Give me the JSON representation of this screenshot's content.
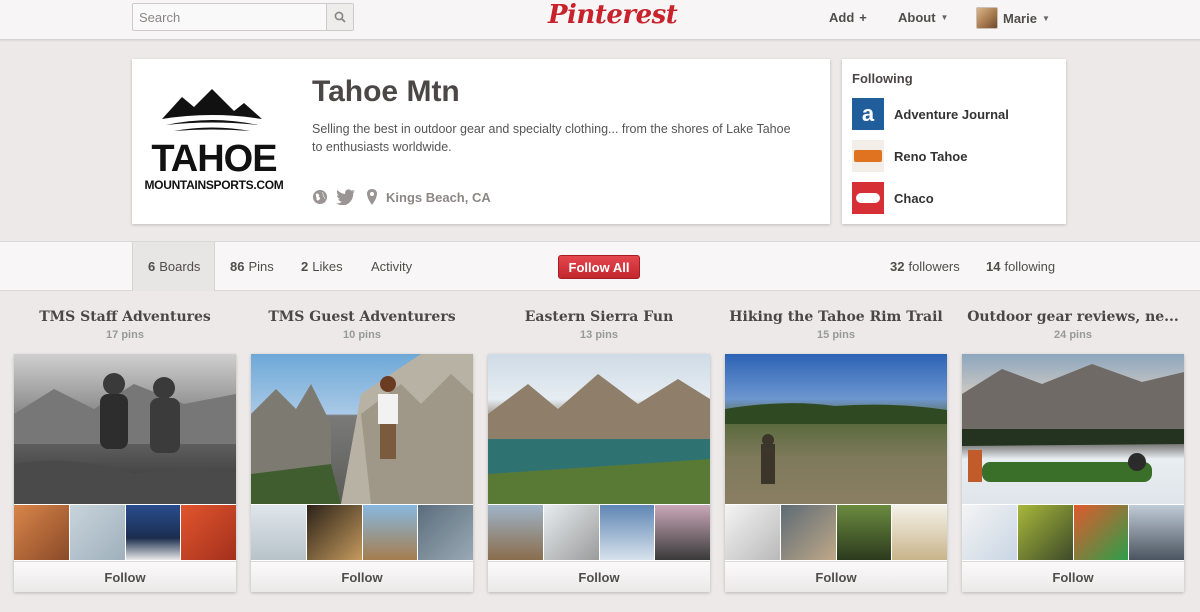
{
  "header": {
    "search_placeholder": "Search",
    "logo": "Pinterest",
    "nav": {
      "add": "Add",
      "about": "About",
      "user": "Marie"
    }
  },
  "profile": {
    "name": "Tahoe Mtn",
    "description": "Selling the best in outdoor gear and specialty clothing... from the shores of Lake Tahoe to enthusiasts worldwide.",
    "location": "Kings Beach, CA",
    "logo_text": {
      "main": "TAHOE",
      "sub": "MOUNTAINSPORTS.COM"
    }
  },
  "following": {
    "title": "Following",
    "items": [
      {
        "name": "Adventure Journal",
        "icon": "adventure-journal-logo"
      },
      {
        "name": "Reno Tahoe",
        "icon": "reno-tahoe-logo"
      },
      {
        "name": "Chaco",
        "icon": "chaco-logo"
      }
    ]
  },
  "tabs": {
    "boards": {
      "count": "6",
      "label": "Boards"
    },
    "pins": {
      "count": "86",
      "label": "Pins"
    },
    "likes": {
      "count": "2",
      "label": "Likes"
    },
    "activity": {
      "label": "Activity"
    }
  },
  "follow_all": "Follow All",
  "stats": {
    "followers": {
      "count": "32",
      "label": "followers"
    },
    "following": {
      "count": "14",
      "label": "following"
    }
  },
  "boards": [
    {
      "title": "TMS Staff Adventures",
      "pins": "17 pins",
      "follow": "Follow"
    },
    {
      "title": "TMS Guest Adventurers",
      "pins": "10 pins",
      "follow": "Follow"
    },
    {
      "title": "Eastern Sierra Fun",
      "pins": "13 pins",
      "follow": "Follow"
    },
    {
      "title": "Hiking the Tahoe Rim Trail",
      "pins": "15 pins",
      "follow": "Follow"
    },
    {
      "title": "Outdoor gear reviews, ne...",
      "pins": "24 pins",
      "follow": "Follow"
    }
  ],
  "colors": {
    "brand_red": "#c8232c",
    "background": "#ece9e8"
  }
}
